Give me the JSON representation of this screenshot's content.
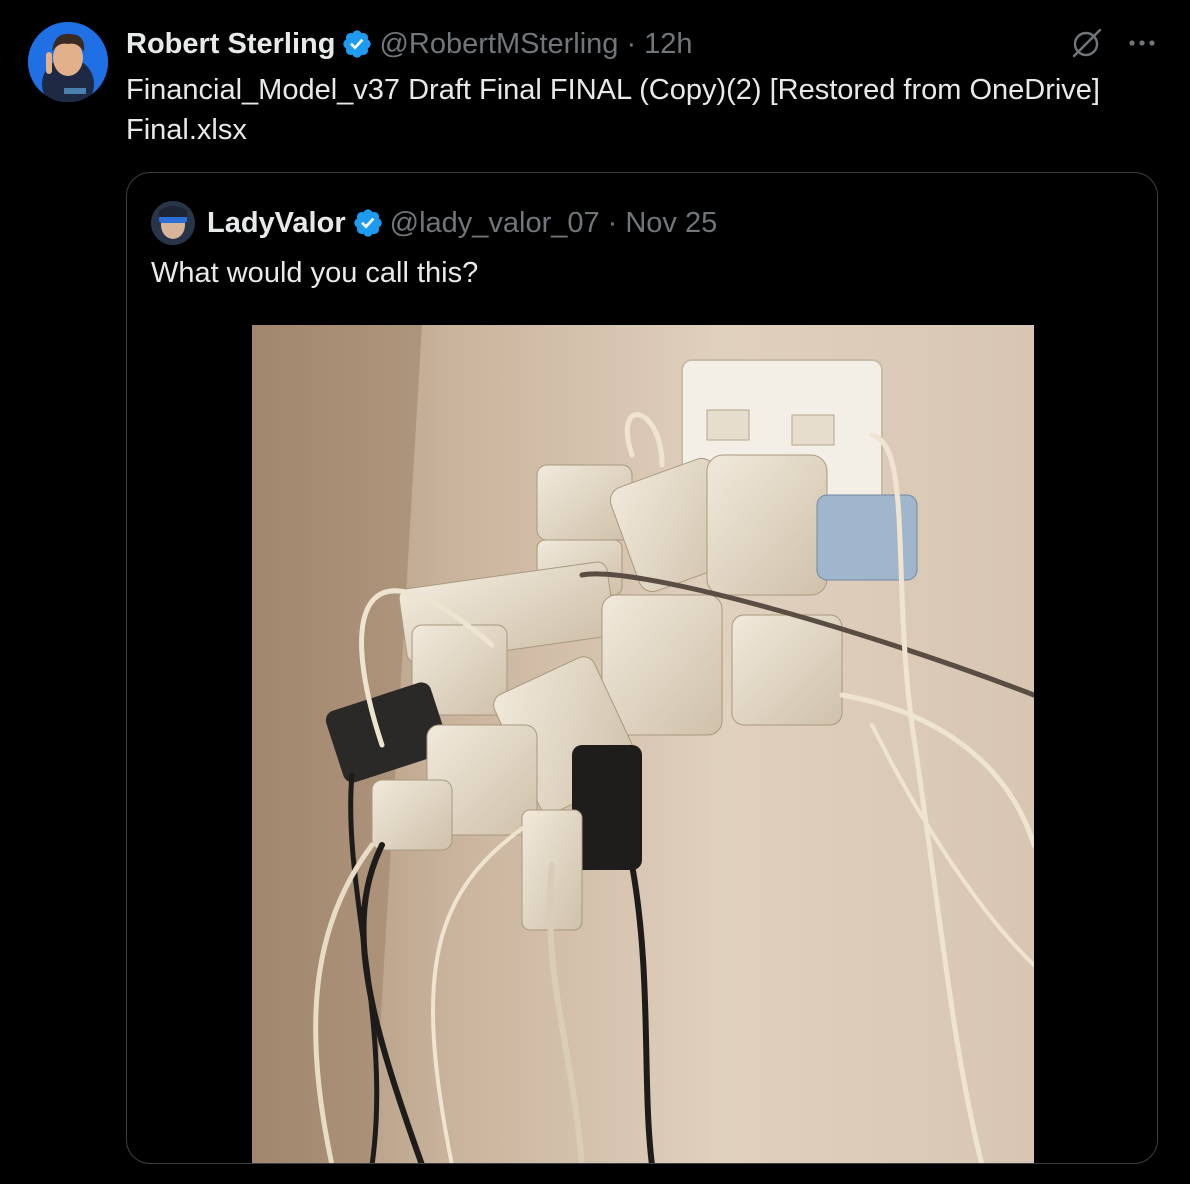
{
  "tweet": {
    "author_name": "Robert Sterling",
    "author_handle": "@RobertMSterling",
    "separator": "·",
    "time": "12h",
    "text": "Financial_Model_v37 Draft Final FINAL (Copy)(2) [Restored from OneDrive] Final.xlsx"
  },
  "quoted": {
    "author_name": "LadyValor",
    "author_handle": "@lady_valor_07",
    "separator": "·",
    "time": "Nov 25",
    "text": "What would you call this?"
  },
  "icons": {
    "verified": "verified-badge-icon",
    "grok": "grok-icon",
    "more": "more-options-icon"
  },
  "colors": {
    "background": "#000000",
    "text": "#e7e9ea",
    "muted": "#71767b",
    "verified_blue": "#1d9bf0",
    "border": "#3a3f44"
  }
}
